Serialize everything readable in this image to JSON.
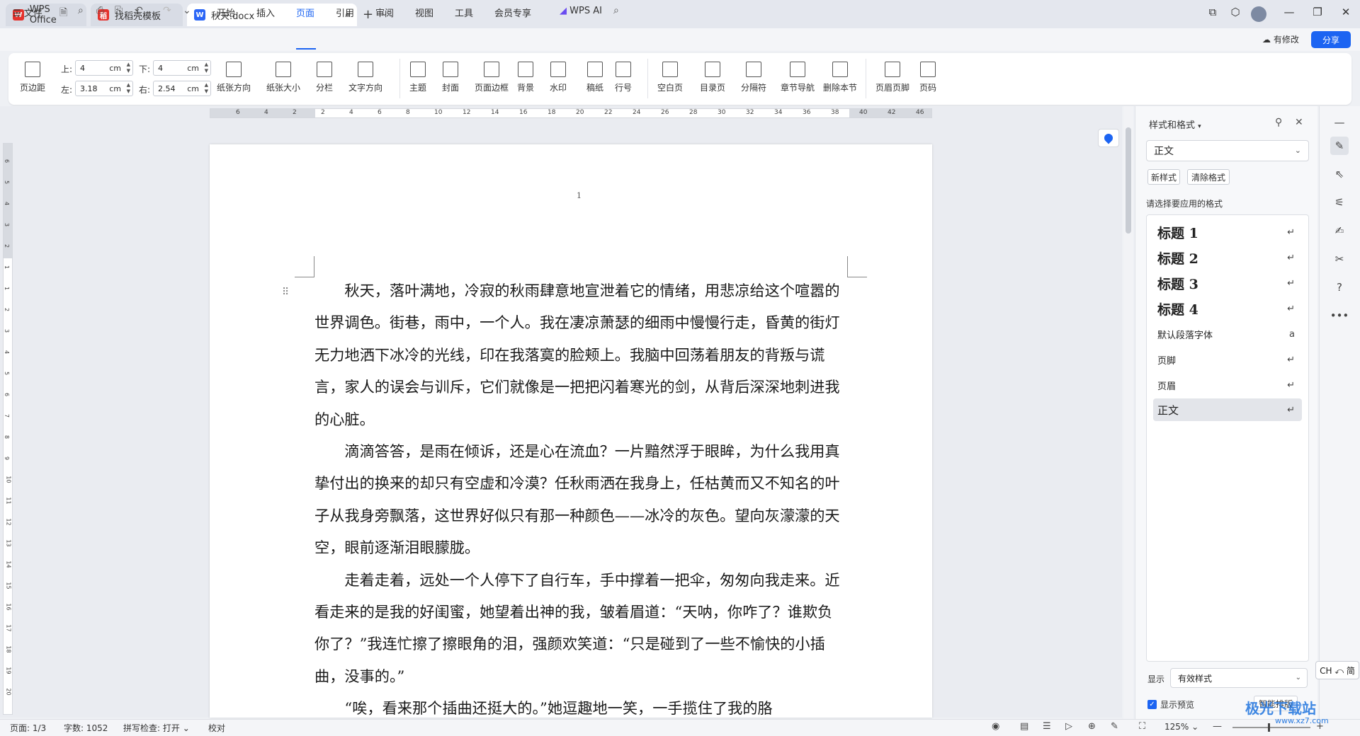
{
  "tabs": [
    {
      "label": "WPS Office",
      "icon": "wps-logo-icon",
      "color": "#e5322d"
    },
    {
      "label": "找稻壳模板",
      "icon": "docer-icon",
      "color": "#e5322d"
    },
    {
      "label": "秋天.docx",
      "icon": "word-doc-icon",
      "color": "#2b66f6"
    }
  ],
  "menu": {
    "file": "文件",
    "items": [
      "开始",
      "插入",
      "页面",
      "引用",
      "审阅",
      "视图",
      "工具",
      "会员专享"
    ],
    "active": "页面",
    "wps_ai": "WPS AI",
    "has_changes": "有修改",
    "share": "分享"
  },
  "ribbon": {
    "margins": {
      "label": "页边距",
      "top_label": "上:",
      "top": "4",
      "bottom_label": "下:",
      "bottom": "4",
      "left_label": "左:",
      "left": "3.18",
      "right_label": "右:",
      "right": "2.54",
      "unit": "cm"
    },
    "buttons": [
      "纸张方向",
      "纸张大小",
      "分栏",
      "文字方向",
      "主题",
      "封面",
      "页面边框",
      "背景",
      "水印",
      "稿纸",
      "行号",
      "空白页",
      "目录页",
      "分隔符",
      "章节导航",
      "删除本节",
      "页眉页脚",
      "页码"
    ]
  },
  "ruler": {
    "h_ticks": [
      "6",
      "4",
      "2",
      "2",
      "4",
      "6",
      "8",
      "10",
      "12",
      "14",
      "16",
      "18",
      "20",
      "22",
      "24",
      "26",
      "28",
      "30",
      "32",
      "34",
      "36",
      "38",
      "40",
      "42",
      "46"
    ],
    "v_ticks": [
      "6",
      "5",
      "4",
      "3",
      "2",
      "1",
      "1",
      "2",
      "3",
      "4",
      "5",
      "6",
      "7",
      "8",
      "9",
      "10",
      "11",
      "12",
      "13",
      "14",
      "15",
      "16",
      "17",
      "18",
      "19",
      "20"
    ]
  },
  "document": {
    "page_number": "1",
    "paragraphs": [
      "秋天，落叶满地，冷寂的秋雨肆意地宣泄着它的情绪，用悲凉给这个喧嚣的世界调色。街巷，雨中，一个人。我在凄凉萧瑟的细雨中慢慢行走，昏黄的街灯无力地洒下冰冷的光线，印在我落寞的脸颊上。我脑中回荡着朋友的背叛与谎言，家人的误会与训斥，它们就像是一把把闪着寒光的剑，从背后深深地刺进我的心脏。",
      "滴滴答答，是雨在倾诉，还是心在流血？一片黯然浮于眼眸，为什么我用真挚付出的换来的却只有空虚和冷漠？任秋雨洒在我身上，任枯黄而又不知名的叶子从我身旁飘落，这世界好似只有那一种颜色——冰冷的灰色。望向灰濛濛的天空，眼前逐渐泪眼朦胧。",
      "走着走着，远处一个人停下了自行车，手中撑着一把伞，匆匆向我走来。近看走来的是我的好闺蜜，她望着出神的我，皱着眉道：“天呐，你咋了？谁欺负你了？”我连忙擦了擦眼角的泪，强颜欢笑道：“只是碰到了一些不愉快的小插曲，没事的。”",
      "“唉，看来那个插曲还挺大的。”她逗趣地一笑，一手揽住了我的胳"
    ]
  },
  "panel": {
    "title": "样式和格式",
    "current_style": "正文",
    "new_style": "新样式",
    "clear_format": "清除格式",
    "subtitle": "请选择要应用的格式",
    "styles": [
      {
        "label": "标题  1",
        "kind": "heading",
        "mark": "↵"
      },
      {
        "label": "标题  2",
        "kind": "heading",
        "mark": "↵"
      },
      {
        "label": "标题  3",
        "kind": "heading",
        "mark": "↵"
      },
      {
        "label": "标题  4",
        "kind": "heading",
        "mark": "↵"
      },
      {
        "label": "默认段落字体",
        "kind": "small",
        "mark": "a"
      },
      {
        "label": "页脚",
        "kind": "small",
        "mark": "↵"
      },
      {
        "label": "页眉",
        "kind": "small",
        "mark": "↵"
      },
      {
        "label": "正文",
        "kind": "small",
        "mark": "↵",
        "selected": true
      }
    ],
    "show_label": "显示",
    "show_value": "有效样式",
    "preview_label": "显示预览",
    "smart_layout": "智能排版"
  },
  "ime": "CH ⤺ 简",
  "status": {
    "page": "页面: 1/3",
    "words": "字数: 1052",
    "spell": "拼写检查: 打开",
    "proof": "校对",
    "zoom": "125%"
  },
  "watermark": {
    "text": "极光下载站",
    "url": "www.xz7.com"
  },
  "colors": {
    "accent": "#1c64f2",
    "wps_red": "#e5322d"
  }
}
